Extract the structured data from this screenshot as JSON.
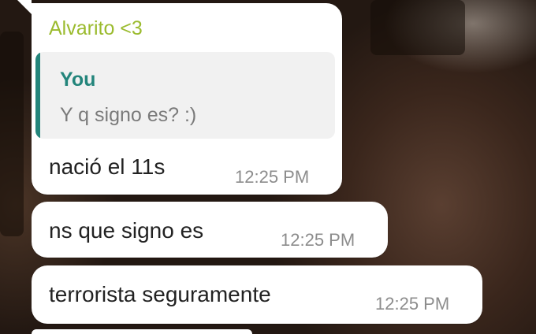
{
  "chat": {
    "messages": [
      {
        "sender": "Alvarito <3",
        "quoted": {
          "author": "You",
          "text": "Y q signo es? :)"
        },
        "text": "nació el 11s",
        "time": "12:25 PM"
      },
      {
        "text": "ns que signo es",
        "time": "12:25 PM"
      },
      {
        "text": "terrorista seguramente",
        "time": "12:25 PM"
      }
    ]
  },
  "colors": {
    "sender_name": "#9bbb2e",
    "quote_accent": "#23857b",
    "bubble": "#ffffff",
    "timestamp": "#8c8c8c",
    "message_text": "#222222"
  }
}
